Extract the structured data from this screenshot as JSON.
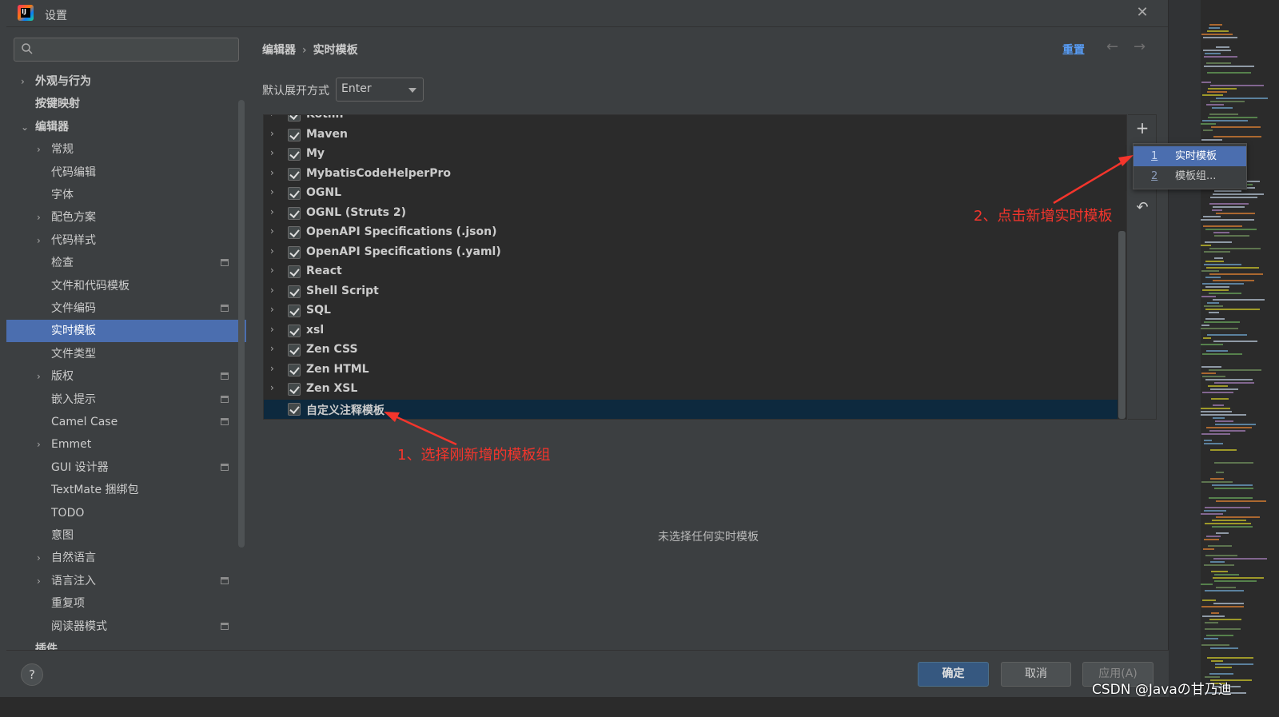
{
  "window": {
    "title": "设置",
    "close_glyph": "✕",
    "app_icon": "intellij-idea-icon"
  },
  "search": {
    "value": "",
    "icon": "search-icon"
  },
  "tree": [
    {
      "label": "外观与行为",
      "arrow": "›",
      "bold": true
    },
    {
      "label": "按键映射",
      "arrow": "",
      "bold": true
    },
    {
      "label": "编辑器",
      "arrow": "⌄",
      "bold": true
    },
    {
      "label": "常规",
      "arrow": "›"
    },
    {
      "label": "代码编辑",
      "arrow": ""
    },
    {
      "label": "字体",
      "arrow": ""
    },
    {
      "label": "配色方案",
      "arrow": "›"
    },
    {
      "label": "代码样式",
      "arrow": "›"
    },
    {
      "label": "检查",
      "arrow": "",
      "proj": true
    },
    {
      "label": "文件和代码模板",
      "arrow": ""
    },
    {
      "label": "文件编码",
      "arrow": "",
      "proj": true
    },
    {
      "label": "实时模板",
      "arrow": "",
      "selected": true
    },
    {
      "label": "文件类型",
      "arrow": ""
    },
    {
      "label": "版权",
      "arrow": "›",
      "proj": true
    },
    {
      "label": "嵌入提示",
      "arrow": "",
      "proj": true
    },
    {
      "label": "Camel Case",
      "arrow": "",
      "proj": true
    },
    {
      "label": "Emmet",
      "arrow": "›"
    },
    {
      "label": "GUI 设计器",
      "arrow": "",
      "proj": true
    },
    {
      "label": "TextMate 捆绑包",
      "arrow": ""
    },
    {
      "label": "TODO",
      "arrow": ""
    },
    {
      "label": "意图",
      "arrow": ""
    },
    {
      "label": "自然语言",
      "arrow": "›"
    },
    {
      "label": "语言注入",
      "arrow": "›",
      "proj": true
    },
    {
      "label": "重复项",
      "arrow": ""
    },
    {
      "label": "阅读器模式",
      "arrow": "",
      "proj": true
    },
    {
      "label": "插件",
      "arrow": "",
      "bold": true
    }
  ],
  "breadcrumb": {
    "parent": "编辑器",
    "separator": "›",
    "current": "实时模板"
  },
  "toolbar": {
    "reset": "重置",
    "back_glyph": "←",
    "forward_glyph": "→"
  },
  "expand": {
    "label": "默认展开方式",
    "value": "Enter"
  },
  "templates": [
    {
      "name": "Kotlin",
      "checked": true,
      "expandable": true
    },
    {
      "name": "Maven",
      "checked": true,
      "expandable": true
    },
    {
      "name": "My",
      "checked": true,
      "expandable": true
    },
    {
      "name": "MybatisCodeHelperPro",
      "checked": true,
      "expandable": true
    },
    {
      "name": "OGNL",
      "checked": true,
      "expandable": true
    },
    {
      "name": "OGNL (Struts 2)",
      "checked": true,
      "expandable": true
    },
    {
      "name": "OpenAPI Specifications (.json)",
      "checked": true,
      "expandable": true
    },
    {
      "name": "OpenAPI Specifications (.yaml)",
      "checked": true,
      "expandable": true
    },
    {
      "name": "React",
      "checked": true,
      "expandable": true
    },
    {
      "name": "Shell Script",
      "checked": true,
      "expandable": true
    },
    {
      "name": "SQL",
      "checked": true,
      "expandable": true
    },
    {
      "name": "xsl",
      "checked": true,
      "expandable": true
    },
    {
      "name": "Zen CSS",
      "checked": true,
      "expandable": true
    },
    {
      "name": "Zen HTML",
      "checked": true,
      "expandable": true
    },
    {
      "name": "Zen XSL",
      "checked": true,
      "expandable": true
    },
    {
      "name": "自定义注释模板",
      "checked": true,
      "expandable": false,
      "selected": true
    }
  ],
  "side_tools": {
    "add_glyph": "+",
    "add_icon": "add-icon",
    "undo_glyph": "↶",
    "undo_icon": "restore-icon"
  },
  "popup": [
    {
      "num": "1",
      "label": "实时模板",
      "selected": true
    },
    {
      "num": "2",
      "label": "模板组..."
    }
  ],
  "empty_message": "未选择任何实时模板",
  "annotations": {
    "step1": "1、选择刚新增的模板组",
    "step2": "2、点击新增实时模板",
    "color": "#f4352c"
  },
  "footer": {
    "help": "?",
    "ok": "确定",
    "cancel": "取消",
    "apply": "应用(A)"
  },
  "watermark": "CSDN @Javaの甘乃迪",
  "colors": {
    "selection": "#4b6eaf",
    "list_selection": "#0d293e",
    "link": "#589df6",
    "primary_button": "#365880"
  }
}
